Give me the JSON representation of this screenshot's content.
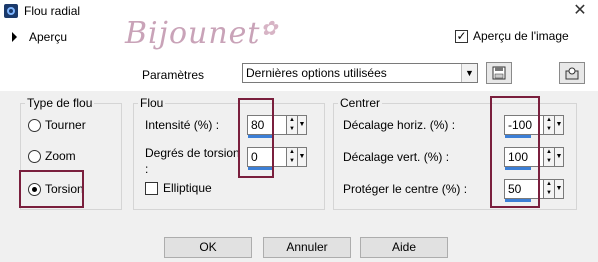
{
  "window": {
    "title": "Flou radial",
    "close_glyph": "✕"
  },
  "preview": {
    "label": "Aperçu",
    "image_preview_label": "Aperçu de l'image",
    "image_preview_checked": true
  },
  "logo": {
    "text": "Bijounet"
  },
  "params": {
    "label": "Paramètres",
    "preset_value": "Dernières options utilisées"
  },
  "blur_type": {
    "title": "Type de flou",
    "options": [
      {
        "label": "Tourner",
        "selected": false
      },
      {
        "label": "Zoom",
        "selected": false
      },
      {
        "label": "Torsion",
        "selected": true
      }
    ]
  },
  "blur": {
    "title": "Flou",
    "intensity_label": "Intensité (%) :",
    "intensity_value": "80",
    "twist_label_1": "Degrés de torsion",
    "twist_label_2": ":",
    "twist_value": "0",
    "elliptic_label": "Elliptique",
    "elliptic_checked": false
  },
  "center": {
    "title": "Centrer",
    "hoffset_label": "Décalage horiz. (%) :",
    "hoffset_value": "-100",
    "voffset_label": "Décalage vert. (%) :",
    "voffset_value": "100",
    "protect_label": "Protéger le centre (%) :",
    "protect_value": "50"
  },
  "buttons": {
    "ok": "OK",
    "cancel": "Annuler",
    "help": "Aide"
  },
  "colors": {
    "highlight": "#7a1f3d",
    "accent": "#3c7fd6"
  },
  "icons": {
    "save": "save-icon",
    "reset": "reset-icon",
    "close": "close-icon"
  }
}
